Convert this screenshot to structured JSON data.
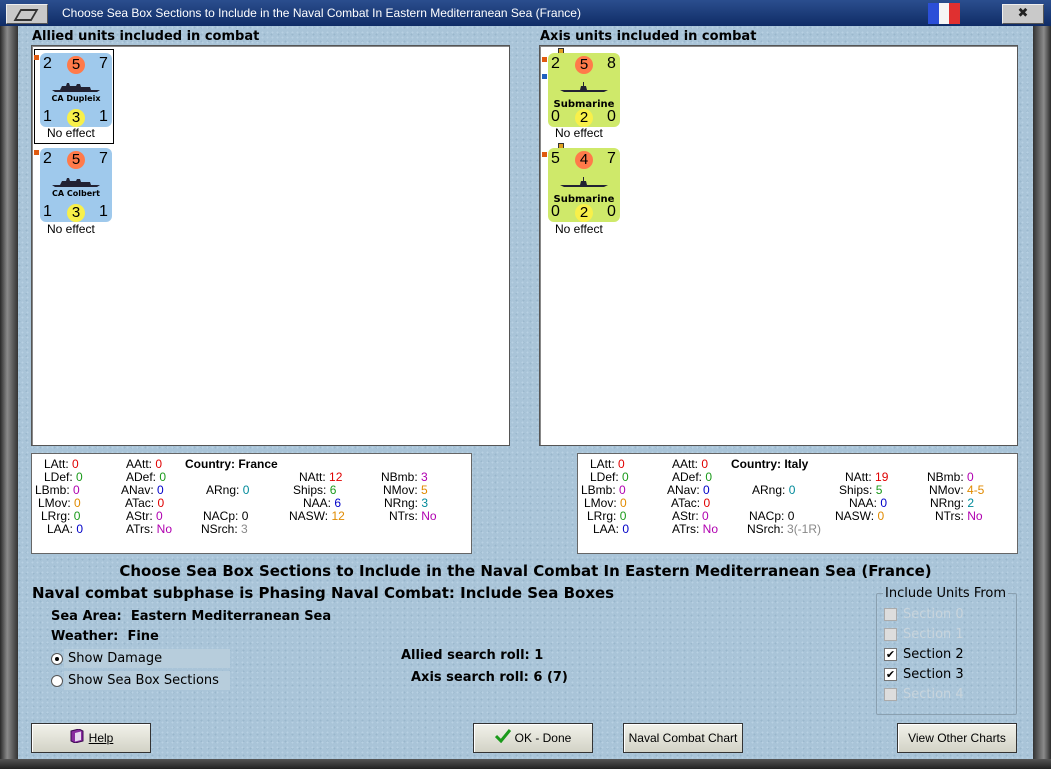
{
  "window": {
    "title": "Choose Sea Box Sections to Include in the Naval Combat In Eastern Mediterranean Sea (France)",
    "close_glyph": "✖",
    "flag_colors": [
      "#2b4fd8",
      "#f5f5f5",
      "#e03030"
    ]
  },
  "allied": {
    "header": "Allied units included in combat",
    "units": [
      {
        "name": "CA Dupleix",
        "top_left": "2",
        "top_mid": "5",
        "top_right": "7",
        "bot_left": "1",
        "bot_mid": "3",
        "bot_right": "1",
        "effect": "No effect"
      },
      {
        "name": "CA Colbert",
        "top_left": "2",
        "top_mid": "5",
        "top_right": "7",
        "bot_left": "1",
        "bot_mid": "3",
        "bot_right": "1",
        "effect": "No effect"
      }
    ]
  },
  "axis": {
    "header": "Axis units included in combat",
    "units": [
      {
        "name": "Submarine",
        "top_left": "2",
        "top_mid": "5",
        "top_right": "8",
        "bot_left": "0",
        "bot_mid": "2",
        "bot_right": "0",
        "effect": "No effect"
      },
      {
        "name": "Submarine",
        "top_left": "5",
        "top_mid": "4",
        "top_right": "7",
        "bot_left": "0",
        "bot_mid": "2",
        "bot_right": "0",
        "effect": "No effect"
      }
    ]
  },
  "stats_allied": {
    "country_label": "Country: France",
    "LAtt": "0",
    "LDef": "0",
    "LBmb": "0",
    "LMov": "0",
    "LRrg": "0",
    "LAA": "0",
    "AAtt": "0",
    "ADef": "0",
    "ANav": "0",
    "ATac": "0",
    "AStr": "0",
    "ATrs": "No",
    "ARng": "0",
    "NACp": "0",
    "NSrch": "3",
    "NAtt": "12",
    "Ships": "6",
    "NAA": "6",
    "NASW": "12",
    "NBmb": "3",
    "NMov": "5",
    "NRng": "3",
    "NTrs": "No"
  },
  "stats_axis": {
    "country_label": "Country: Italy",
    "LAtt": "0",
    "LDef": "0",
    "LBmb": "0",
    "LMov": "0",
    "LRrg": "0",
    "LAA": "0",
    "AAtt": "0",
    "ADef": "0",
    "ANav": "0",
    "ATac": "0",
    "AStr": "0",
    "ATrs": "No",
    "ARng": "0",
    "NACp": "0",
    "NSrch": "3(-1R)",
    "NAtt": "19",
    "Ships": "5",
    "NAA": "0",
    "NASW": "0",
    "NBmb": "0",
    "NMov": "4-5",
    "NRng": "2",
    "NTrs": "No"
  },
  "heading": "Choose Sea Box Sections to Include in the Naval Combat In Eastern Mediterranean Sea (France)",
  "subphase": "Naval combat subphase is Phasing Naval Combat: Include Sea Boxes",
  "sea_area_label": "Sea Area:",
  "sea_area": "Eastern Mediterranean Sea",
  "weather_label": "Weather:",
  "weather": "Fine",
  "options": {
    "show_damage": "Show Damage",
    "show_sections": "Show Sea Box Sections"
  },
  "allied_roll": "Allied search roll: 1",
  "axis_roll": "Axis search roll: 6 (7)",
  "include": {
    "title": "Include Units From",
    "sections": [
      {
        "label": "Section 0",
        "checked": false,
        "enabled": false
      },
      {
        "label": "Section 1",
        "checked": false,
        "enabled": false
      },
      {
        "label": "Section 2",
        "checked": true,
        "enabled": true
      },
      {
        "label": "Section 3",
        "checked": true,
        "enabled": true
      },
      {
        "label": "Section 4",
        "checked": false,
        "enabled": false
      }
    ]
  },
  "buttons": {
    "help": "Help",
    "ok": "OK - Done",
    "naval_chart": "Naval Combat Chart",
    "other_charts": "View Other Charts"
  },
  "colors": {
    "red_circle": "#ff7a4a",
    "yellow_circle": "#f8f04a",
    "stat_red": "#e00000",
    "stat_green": "#1a9a1a",
    "stat_purple": "#b000b0",
    "stat_blue": "#0000c8",
    "stat_orange": "#e08a00",
    "stat_teal": "#008a9a"
  }
}
